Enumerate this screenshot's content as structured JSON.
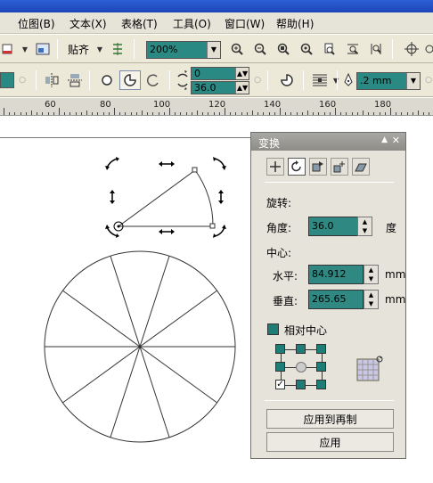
{
  "menubar": {
    "items": [
      "位图(B)",
      "文本(X)",
      "表格(T)",
      "工具(O)",
      "窗口(W)",
      "帮助(H)"
    ]
  },
  "toolbar": {
    "snap_label": "贴齐",
    "zoom_value": "200%"
  },
  "property_bar": {
    "angle_start": "0",
    "angle_end": "36.0",
    "outline_width": ".2 mm"
  },
  "ruler": {
    "labels": [
      "60",
      "80",
      "100",
      "120",
      "140",
      "160",
      "180"
    ]
  },
  "transform_panel": {
    "title": "变换",
    "rotation_heading": "旋转:",
    "angle_label": "角度:",
    "angle_value": "36.0",
    "angle_unit": "度",
    "center_heading": "中心:",
    "horizontal_label": "水平:",
    "horizontal_value": "84.912",
    "horizontal_unit": "mm",
    "vertical_label": "垂直:",
    "vertical_value": "265.65",
    "vertical_unit": "mm",
    "relative_center_label": "相对中心",
    "apply_to_duplicate_label": "应用到再制",
    "apply_label": "应用"
  },
  "colors": {
    "field_teal": "#2f8882",
    "panel_bg": "#e6e3db",
    "title_bar": "#9a9893"
  }
}
